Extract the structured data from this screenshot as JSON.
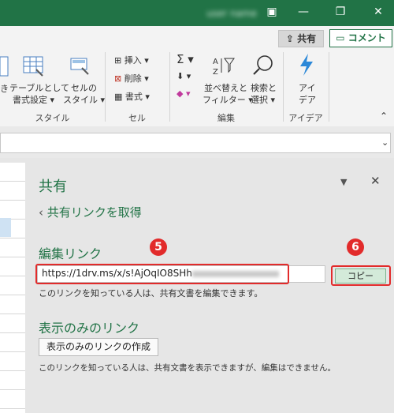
{
  "titlebar": {
    "blurred_text": "user name",
    "restore_icon": "restore-icon",
    "maximize_icon": "maximize-icon",
    "close_icon": "close-icon"
  },
  "ribbon": {
    "share_label": "共有",
    "comment_label": "コメント",
    "styles_group": {
      "partial_label": "き",
      "table_label": "テーブルとして",
      "table_label2": "書式設定",
      "cell_label": "セルの",
      "cell_label2": "スタイル",
      "group_name": "スタイル"
    },
    "cells_group": {
      "insert": "挿入",
      "delete": "削除",
      "format": "書式",
      "group_name": "セル"
    },
    "edit_group": {
      "sort_label": "並べ替えと",
      "sort_label2": "フィルター",
      "find_label": "検索と",
      "find_label2": "選択",
      "group_name": "編集"
    },
    "ideas_group": {
      "ideas_label": "アイ",
      "ideas_label2": "デア",
      "group_name": "アイデア"
    }
  },
  "pane": {
    "title": "共有",
    "back_label": "共有リンクを取得",
    "edit_heading": "編集リンク",
    "url": "https://1drv.ms/x/s!AjOqIO8SHh",
    "copy_label": "コピー",
    "edit_note": "このリンクを知っている人は、共有文書を編集できます。",
    "view_heading": "表示のみのリンク",
    "create_label": "表示のみのリンクの作成",
    "view_note": "このリンクを知っている人は、共有文書を表示できますが、編集はできません。",
    "marker5": "5",
    "marker6": "6"
  }
}
